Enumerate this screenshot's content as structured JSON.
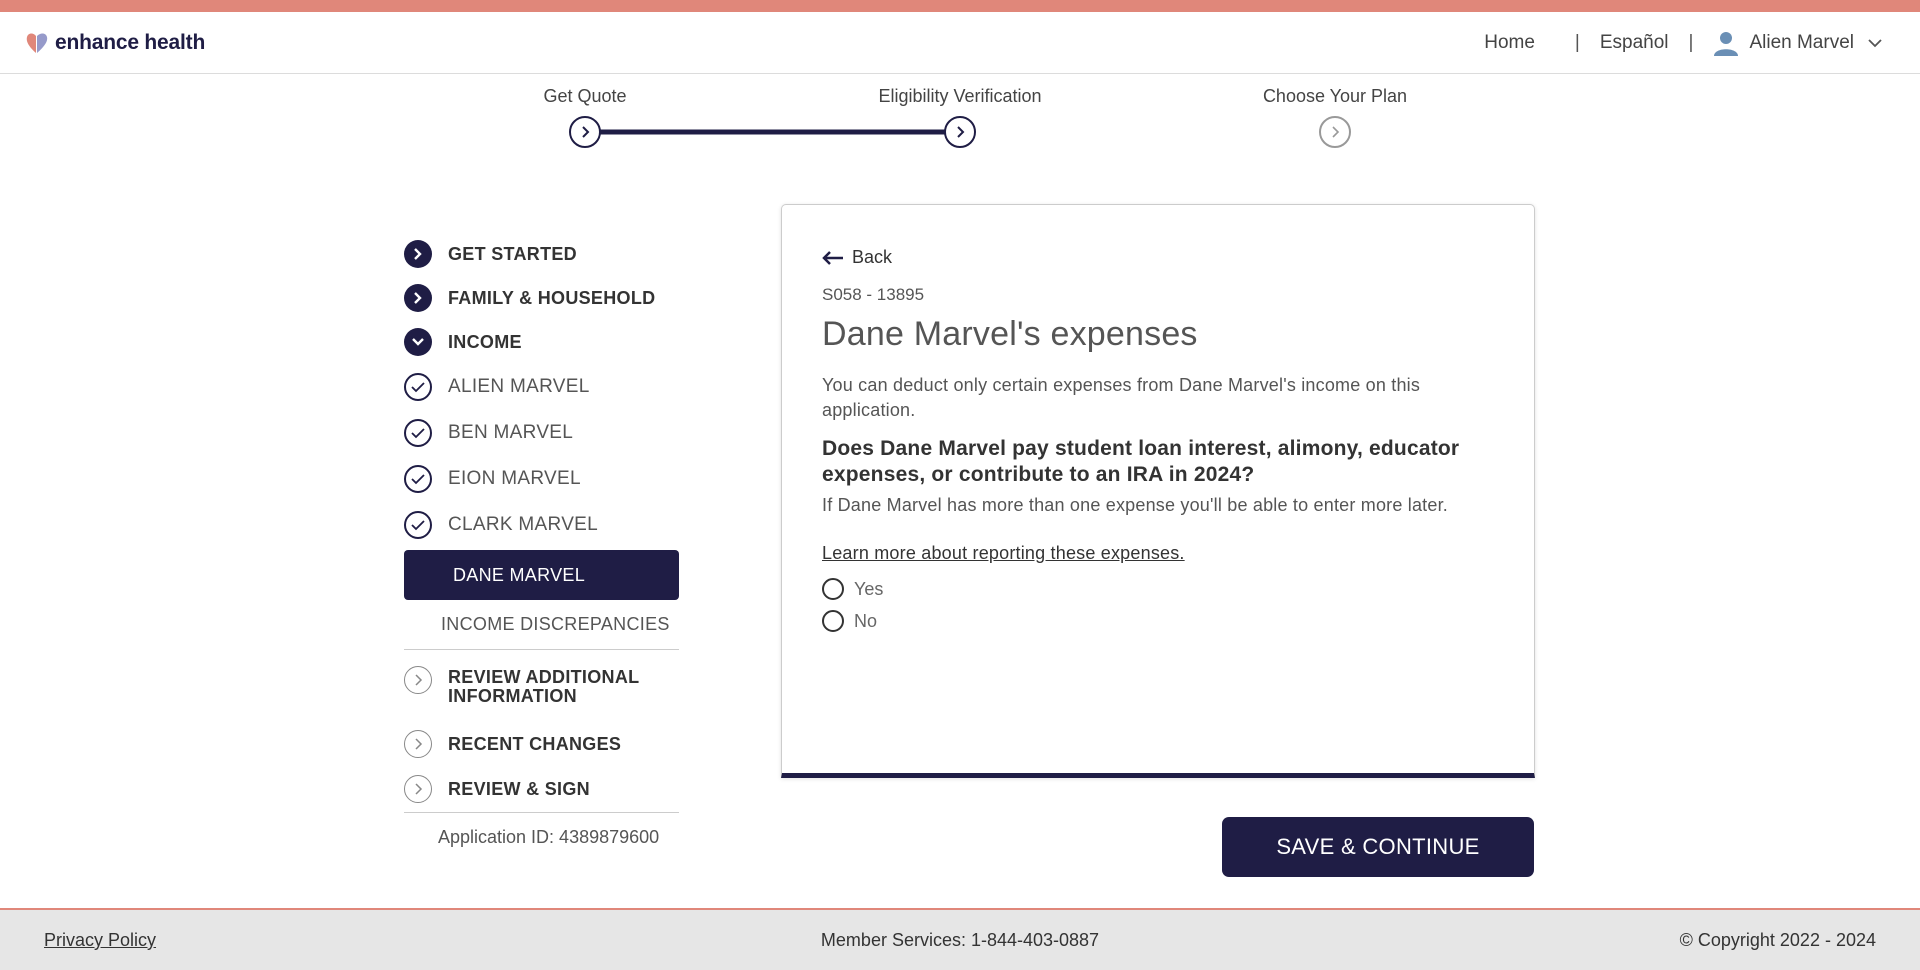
{
  "brand": {
    "name": "enhance health"
  },
  "nav": {
    "home": "Home",
    "separator": "|",
    "language": "Español",
    "user_name": "Alien Marvel"
  },
  "stepper": {
    "steps": [
      {
        "label": "Get Quote",
        "status": "complete"
      },
      {
        "label": "Eligibility Verification",
        "status": "current"
      },
      {
        "label": "Choose Your Plan",
        "status": "upcoming"
      }
    ]
  },
  "sidebar": {
    "items": [
      {
        "label": "GET STARTED",
        "state": "complete"
      },
      {
        "label": "FAMILY & HOUSEHOLD",
        "state": "complete"
      },
      {
        "label": "INCOME",
        "state": "expanded"
      }
    ],
    "income_members": [
      {
        "label": "ALIEN MARVEL",
        "state": "checked"
      },
      {
        "label": "BEN MARVEL",
        "state": "checked"
      },
      {
        "label": "EION MARVEL",
        "state": "checked"
      },
      {
        "label": "CLARK MARVEL",
        "state": "checked"
      }
    ],
    "active_item": "DANE MARVEL",
    "sub_item": "INCOME DISCREPANCIES",
    "later_items": [
      {
        "label": "REVIEW ADDITIONAL INFORMATION"
      },
      {
        "label": "RECENT CHANGES"
      },
      {
        "label": "REVIEW & SIGN"
      }
    ],
    "application_id": "Application ID: 4389879600"
  },
  "card": {
    "back_label": "Back",
    "code": "S058 - 13895",
    "title": "Dane Marvel's expenses",
    "description": "You can deduct only certain expenses from Dane Marvel's income on this application.",
    "question": "Does Dane Marvel pay student loan interest, alimony, educator expenses, or contribute to an IRA in 2024?",
    "hint": "If Dane Marvel has more than one expense you'll be able to enter more later.",
    "learn_more": "Learn more about reporting these expenses.",
    "options": [
      {
        "label": "Yes"
      },
      {
        "label": "No"
      }
    ]
  },
  "actions": {
    "save_continue": "SAVE & CONTINUE"
  },
  "footer": {
    "privacy": "Privacy Policy",
    "member_services": "Member Services: 1-844-403-0887",
    "copyright": "© Copyright 2022 - 2024"
  },
  "colors": {
    "brand_navy": "#1f1d45",
    "accent_salmon": "#e0877a",
    "footer_bg": "#e6e6e6"
  }
}
